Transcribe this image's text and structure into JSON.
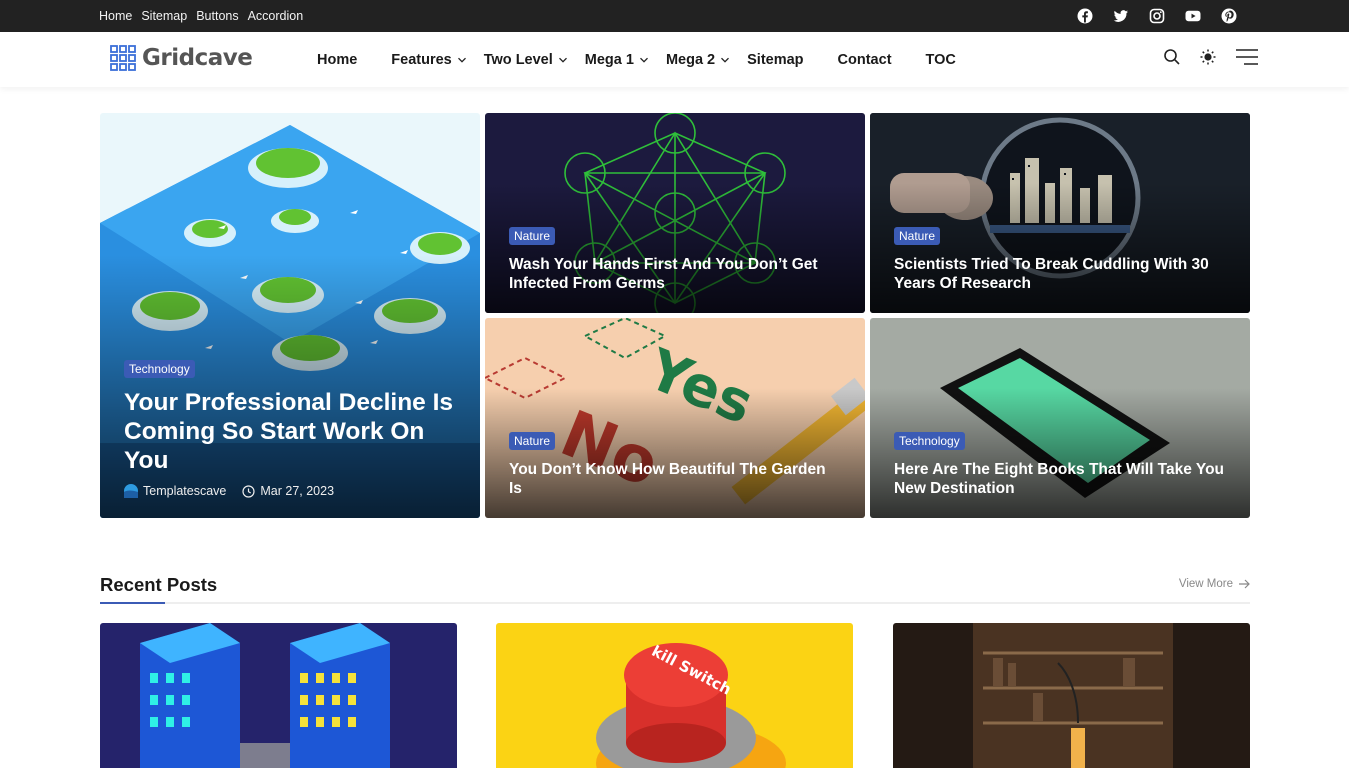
{
  "topbar": {
    "links": [
      "Home",
      "Sitemap",
      "Buttons",
      "Accordion"
    ],
    "social": [
      "facebook-icon",
      "twitter-icon",
      "instagram-icon",
      "youtube-icon",
      "pinterest-icon"
    ]
  },
  "header": {
    "logo": "Gridcave",
    "nav": [
      {
        "label": "Home",
        "dropdown": false
      },
      {
        "label": "Features",
        "dropdown": true
      },
      {
        "label": "Two Level",
        "dropdown": true
      },
      {
        "label": "Mega 1",
        "dropdown": true
      },
      {
        "label": "Mega 2",
        "dropdown": true
      },
      {
        "label": "Sitemap",
        "dropdown": false
      },
      {
        "label": "Contact",
        "dropdown": false
      },
      {
        "label": "TOC",
        "dropdown": false
      }
    ],
    "icons": [
      "search-icon",
      "sun-icon",
      "menu-icon"
    ]
  },
  "featured": {
    "main": {
      "category": "Technology",
      "title": "Your Professional Decline Is Coming So Start Work On You",
      "author": "Templatescave",
      "date": "Mar 27, 2023"
    },
    "items": [
      {
        "category": "Nature",
        "title": "Wash Your Hands First And You Don’t Get Infected From Germs"
      },
      {
        "category": "Nature",
        "title": "Scientists Tried To Break Cuddling With 30 Years Of Research"
      },
      {
        "category": "Nature",
        "title": "You Don’t Know How Beautiful The Garden Is"
      },
      {
        "category": "Technology",
        "title": "Here Are The Eight Books That Will Take You New Destination"
      }
    ]
  },
  "recent": {
    "title": "Recent Posts",
    "view_more": "View More"
  },
  "colors": {
    "accent": "#3b5bb5",
    "topbar": "#222222"
  }
}
